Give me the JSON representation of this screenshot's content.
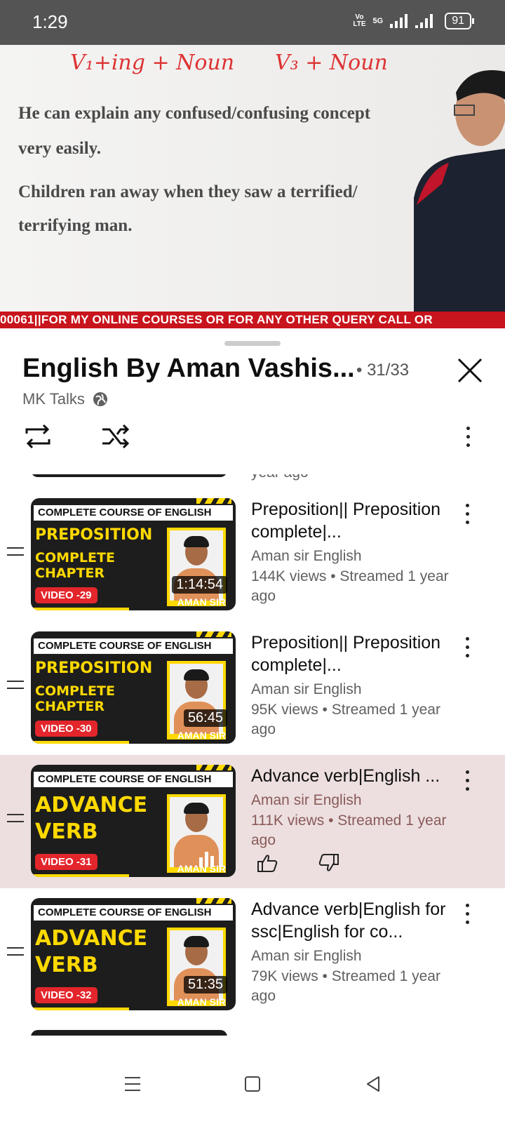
{
  "status_bar": {
    "time": "1:29",
    "volte_line1": "Vo",
    "volte_line2": "LTE",
    "network": "5G",
    "battery": "91"
  },
  "video": {
    "handwriting_left": "V₁+ing + Noun",
    "handwriting_right": "V₃ + Noun",
    "line1": "He can explain any confused/confusing concept",
    "line2": "very easily.",
    "line3": "Children ran away when they saw a terrified/",
    "line4": "terrifying man.",
    "ticker": "00061||FOR MY ONLINE COURSES OR FOR ANY OTHER QUERY CALL OR"
  },
  "playlist": {
    "title": "English By Aman Vashis...",
    "position": "• 31/33",
    "channel": "MK Talks",
    "partial_top_text": "year ago"
  },
  "items": [
    {
      "title": "Preposition|| Preposition complete|...",
      "channel": "Aman sir English",
      "views": "144K views • Streamed 1 year ago",
      "thumb_header": "COMPLETE COURSE OF ENGLISH",
      "thumb_big1": "PREPOSITION",
      "thumb_big2": "COMPLETE",
      "thumb_big3": "CHAPTER",
      "thumb_video": "VIDEO -29",
      "duration": "1:14:54",
      "thumb_name": "AMAN SIR"
    },
    {
      "title": "Preposition|| Preposition complete|...",
      "channel": "Aman sir English",
      "views": "95K views • Streamed 1 year ago",
      "thumb_header": "COMPLETE COURSE OF ENGLISH",
      "thumb_big1": "PREPOSITION",
      "thumb_big2": "COMPLETE",
      "thumb_big3": "CHAPTER",
      "thumb_video": "VIDEO -30",
      "duration": "56:45",
      "thumb_name": "AMAN SIR"
    },
    {
      "title": "Advance verb|English ...",
      "channel": "Aman sir English",
      "views": "111K views • Streamed 1 year ago",
      "thumb_header": "COMPLETE COURSE OF ENGLISH",
      "thumb_big1": "ADVANCE",
      "thumb_big2": "VERB",
      "thumb_video": "VIDEO -31",
      "thumb_name": "AMAN SIR"
    },
    {
      "title": "Advance verb|English for ssc|English for co...",
      "channel": "Aman sir English",
      "views": "79K views • Streamed 1 year ago",
      "thumb_header": "COMPLETE COURSE OF ENGLISH",
      "thumb_big1": "ADVANCE",
      "thumb_big2": "VERB",
      "thumb_video": "VIDEO -32",
      "duration": "51:35",
      "thumb_name": "AMAN SIR"
    }
  ],
  "colors": {
    "accent_yellow": "#ffd900",
    "active_row": "#eddfdf",
    "ticker_red": "#c8141c"
  }
}
